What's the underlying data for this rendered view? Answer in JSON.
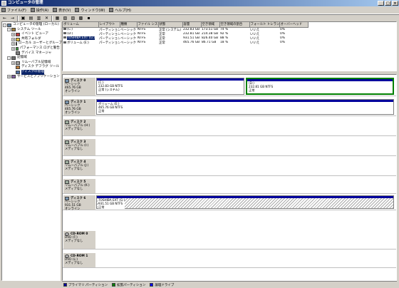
{
  "window": {
    "title": "コンピュータの管理"
  },
  "menu": [
    {
      "label": "ファイル(F)"
    },
    {
      "label": "操作(A)"
    },
    {
      "label": "表示(V)"
    },
    {
      "label": "ウィンドウ(W)"
    },
    {
      "label": "ヘルプ(H)"
    }
  ],
  "toolbar": [
    "←",
    "→",
    "▣",
    "▤",
    "▥",
    "✕",
    "▦",
    "▧",
    "▨",
    "▩",
    "▪"
  ],
  "tree": [
    {
      "label": "コンピュータの管理 (ローカル)",
      "level": 0,
      "exp": "-",
      "icon": "computer"
    },
    {
      "label": "システム ツール",
      "level": 1,
      "exp": "-",
      "icon": "tools"
    },
    {
      "label": "イベント ビューア",
      "level": 2,
      "exp": "+",
      "icon": "event"
    },
    {
      "label": "共有フォルダ",
      "level": 2,
      "exp": "+",
      "icon": "folder"
    },
    {
      "label": "ローカル ユーザーとグループ",
      "level": 2,
      "exp": "+",
      "icon": "users"
    },
    {
      "label": "パフォーマンス ログと警告",
      "level": 2,
      "exp": "+",
      "icon": "perf"
    },
    {
      "label": "デバイス マネージャ",
      "level": 2,
      "exp": "",
      "icon": "device"
    },
    {
      "label": "記憶域",
      "level": 1,
      "exp": "-",
      "icon": "storage"
    },
    {
      "label": "リムーバブル記憶域",
      "level": 2,
      "exp": "+",
      "icon": "removable"
    },
    {
      "label": "ディスク デフラグ ツール",
      "level": 2,
      "exp": "",
      "icon": "defrag"
    },
    {
      "label": "ディスクの管理",
      "level": 2,
      "exp": "",
      "icon": "diskmgmt",
      "selected": true
    },
    {
      "label": "サービスとアプリケーション",
      "level": 1,
      "exp": "+",
      "icon": "services"
    }
  ],
  "volumes": {
    "headers": [
      "ボリューム",
      "レイアウト",
      "種類",
      "ファイル システム",
      "状態",
      "容量",
      "空き領域",
      "空き領域の割合",
      "フォールト トレランス",
      "オーバーヘッド"
    ],
    "rows": [
      [
        "(C:)",
        "パーティション",
        "ベーシック",
        "NTFS",
        "正常 (システム)",
        "232.83 GB",
        "173.51 GB",
        "74 %",
        "いいえ",
        "0%"
      ],
      [
        "(D:)",
        "パーティション",
        "ベーシック",
        "NTFS",
        "正常",
        "232.81 GB",
        "214.38 GB",
        "92 %",
        "いいえ",
        "0%"
      ],
      [
        "TOSHIBA EXT (G:)",
        "パーティション",
        "ベーシック",
        "NTFS",
        "正常",
        "931.51 GB",
        "826.40 GB",
        "88 %",
        "いいえ",
        "0%"
      ],
      [
        "ボリューム (E:)",
        "パーティション",
        "ベーシック",
        "NTFS",
        "正常",
        "465.76 GB",
        "86.71 GB",
        "18 %",
        "いいえ",
        "0%"
      ]
    ],
    "selected_row": 2
  },
  "disks": [
    {
      "name": "ディスク 0",
      "type": "ベーシック",
      "size": "465.76 GB",
      "status": "オンライン",
      "icon": "disk",
      "parts": [
        {
          "title": "(C:)",
          "line2": "232.83 GB NTFS",
          "line3": "正常 (システム)",
          "bar": "#00009c"
        },
        {
          "title": "(D:)",
          "line2": "232.81 GB NTFS",
          "line3": "正常",
          "bar": "#00009c",
          "selected": true
        }
      ]
    },
    {
      "name": "ディスク 1",
      "type": "ベーシック",
      "size": "465.76 GB",
      "status": "オンライン",
      "icon": "disk",
      "parts": [
        {
          "title": "ボリューム (E:)",
          "line2": "465.76 GB NTFS",
          "line3": "正常",
          "bar": "#00009c"
        }
      ]
    },
    {
      "name": "ディスク 2",
      "type": "リムーバブル (H:)",
      "size": "",
      "status": "メディアなし",
      "icon": "rem",
      "parts": []
    },
    {
      "name": "ディスク 3",
      "type": "リムーバブル (I:)",
      "size": "",
      "status": "メディアなし",
      "icon": "rem",
      "parts": []
    },
    {
      "name": "ディスク 4",
      "type": "リムーバブル (J:)",
      "size": "",
      "status": "メディアなし",
      "icon": "rem",
      "parts": []
    },
    {
      "name": "ディスク 5",
      "type": "リムーバブル (K:)",
      "size": "",
      "status": "メディアなし",
      "icon": "rem",
      "parts": []
    },
    {
      "name": "ディスク 6",
      "type": "ベーシック",
      "size": "931.51 GB",
      "status": "オンライン",
      "icon": "disk",
      "parts": [
        {
          "title": "TOSHIBA EXT (G:)",
          "line2": "931.51 GB NTFS",
          "line3": "正常",
          "bar": "#00009c",
          "hatch": true
        }
      ]
    },
    {
      "name": "CD-ROM 0",
      "type": "DVD (F:)",
      "size": "",
      "status": "メディアなし",
      "icon": "cd",
      "parts": []
    },
    {
      "name": "CD-ROM 1",
      "type": "DVD (L:)",
      "size": "",
      "status": "メディアなし",
      "icon": "cd",
      "parts": []
    }
  ],
  "legend": [
    {
      "label": "プライマリ パーティション",
      "color": "#00009c"
    },
    {
      "label": "拡張パーティション",
      "color": "#008000"
    },
    {
      "label": "論理ドライブ",
      "color": "#0000ff"
    }
  ],
  "colors": {
    "selection": "#0a246a",
    "primary": "#00009c",
    "selected_part_border": "#008000"
  }
}
